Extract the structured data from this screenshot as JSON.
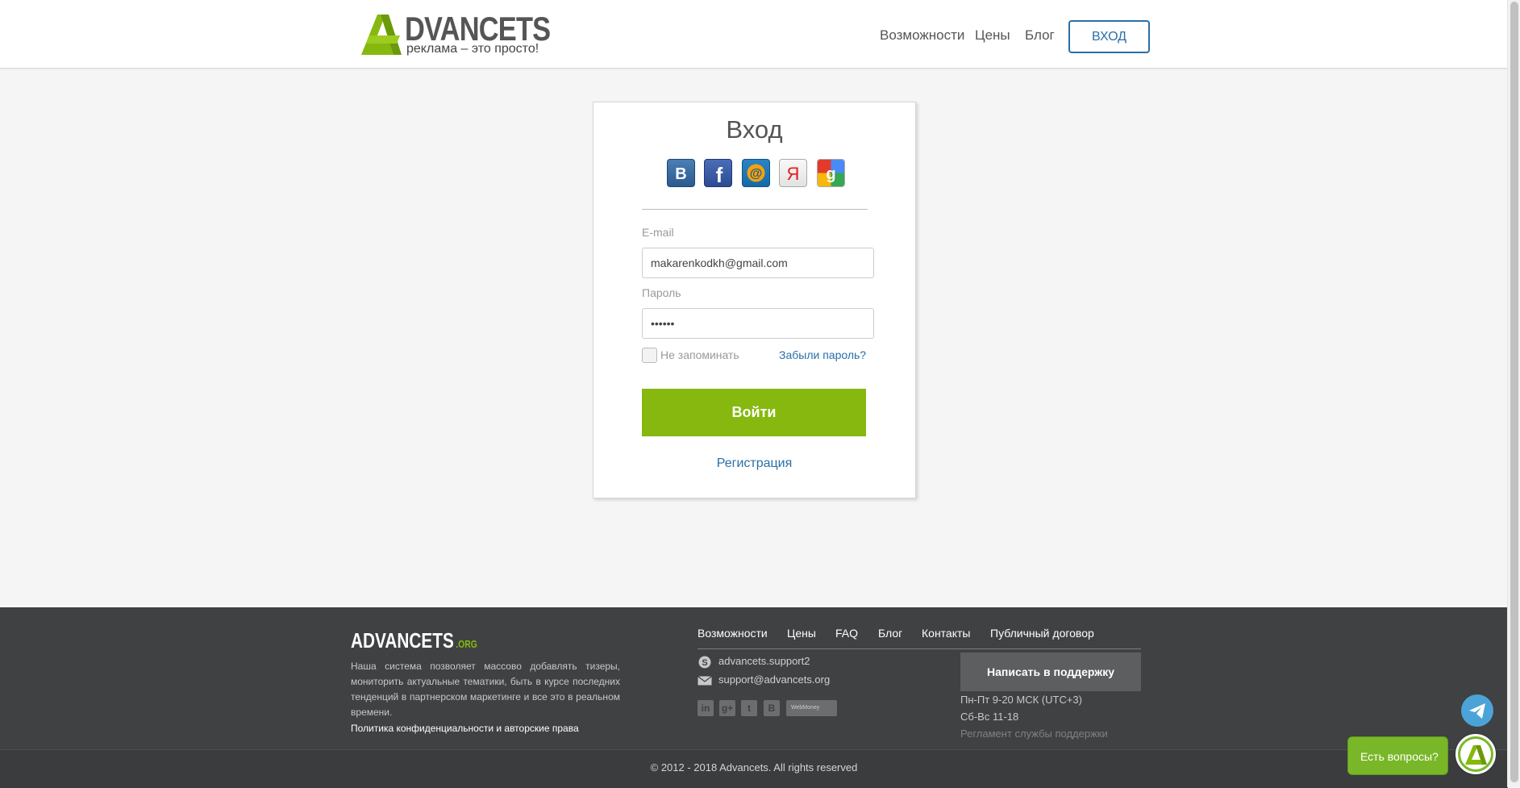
{
  "header": {
    "logo_word": "DVANCETS",
    "logo_tagline": "реклама – это просто!",
    "nav": [
      "Возможности",
      "Цены",
      "Блог"
    ],
    "login_button": "ВХОД"
  },
  "login": {
    "title": "Вход",
    "social_icons": [
      "vk-icon",
      "facebook-icon",
      "mailru-icon",
      "yandex-icon",
      "google-icon"
    ],
    "email_label": "E-mail",
    "email_value": "makarenkodkh@gmail.com",
    "password_label": "Пароль",
    "password_value": "••••••",
    "remember_label": "Не запоминать",
    "remember_checked": false,
    "forgot_link": "Забыли пароль?",
    "submit_button": "Войти",
    "register_link": "Регистрация"
  },
  "footer": {
    "logo_word": "ADVANCETS",
    "logo_tld": ".ORG",
    "description": "Наша система позволяет массово добавлять тизеры, мониторить актуальные тематики, быть в курсе последних тенденций в партнерском маркетинге и все это в реальном времени.",
    "policy_link": "Политика конфиденциальности и авторские права",
    "nav": [
      "Возможности",
      "Цены",
      "FAQ",
      "Блог",
      "Контакты",
      "Публичный договор"
    ],
    "skype": "advancets.support2",
    "email": "support@advancets.org",
    "social_small": [
      "in",
      "g+",
      "t",
      "В"
    ],
    "webmoney_label": "WebMoney",
    "support_button": "Написать в поддержку",
    "hours_weekdays": "Пн-Пт 9-20 МСК (UTC+3)",
    "hours_weekend": "Сб-Вс 11-18",
    "reglament_link": "Регламент службы поддержки",
    "copyright": "© 2012 - 2018 Advancets. All rights reserved"
  },
  "widgets": {
    "chat_bubble": "Есть вопросы?"
  },
  "colors": {
    "accent_green": "#86b80f",
    "link_blue": "#2a6ea6",
    "footer_bg": "#3f4143"
  }
}
